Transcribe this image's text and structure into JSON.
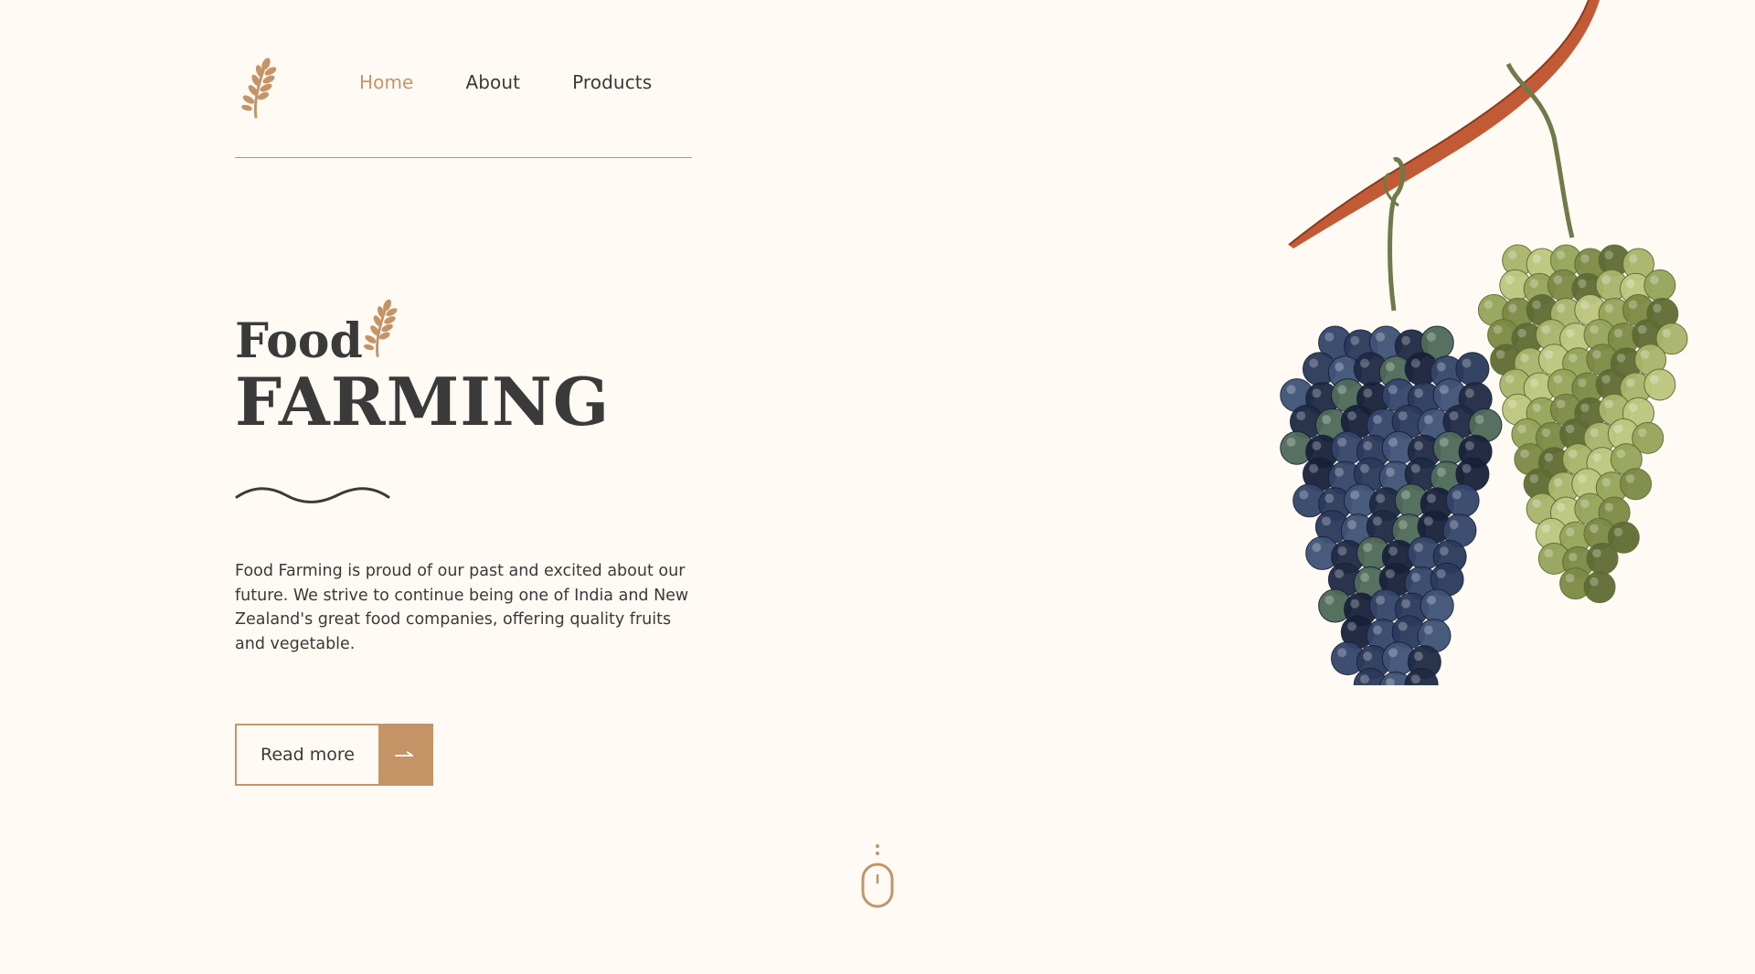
{
  "nav": {
    "items": [
      {
        "label": "Home",
        "active": true
      },
      {
        "label": "About",
        "active": false
      },
      {
        "label": "Products",
        "active": false
      }
    ]
  },
  "hero": {
    "title_line1": "Food",
    "title_line2": "FARMING",
    "description": "Food Farming is proud of our past and excited about our future. We strive to continue being one of India and New Zealand's great food companies, offering quality fruits and vegetable.",
    "button_label": "Read more"
  },
  "colors": {
    "accent": "#c49467",
    "text": "#3a3a3a",
    "background": "#fffaf4"
  },
  "icons": {
    "logo": "wheat-icon",
    "title_decoration": "wheat-icon",
    "button": "arrow-right-icon",
    "scroll": "mouse-scroll-icon"
  }
}
